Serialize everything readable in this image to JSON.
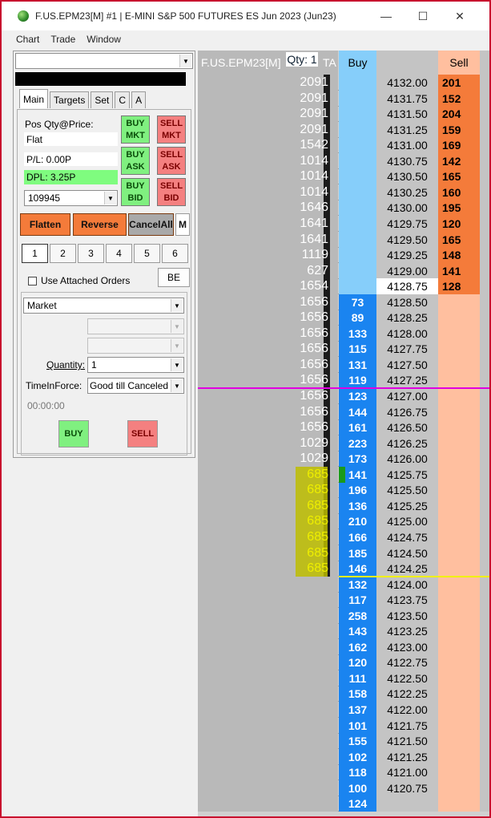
{
  "window": {
    "title": "F.US.EPM23[M]  #1 | E-MINI S&P 500 FUTURES ES Jun 2023 (Jun23)",
    "minimize": "—",
    "maximize": "☐",
    "close": "✕"
  },
  "menu": [
    "Chart",
    "Trade",
    "Window"
  ],
  "panel": {
    "account_value": "",
    "tabs": [
      "Main",
      "Targets",
      "Set",
      "C",
      "A"
    ],
    "pos_label": "Pos Qty@Price:",
    "pos_value": "Flat",
    "pl": "P/L: 0.00P",
    "dpl": "DPL: 3.25P",
    "account_id": "109945",
    "trade_buttons": [
      [
        "BUY",
        "MKT"
      ],
      [
        "SELL",
        "MKT"
      ],
      [
        "BUY",
        "ASK"
      ],
      [
        "SELL",
        "ASK"
      ],
      [
        "BUY",
        "BID"
      ],
      [
        "SELL",
        "BID"
      ]
    ],
    "flatten": "Flatten",
    "reverse": "Reverse",
    "cancel_all": "CancelAll",
    "m": "M",
    "numbers": [
      "1",
      "2",
      "3",
      "4",
      "5",
      "6"
    ],
    "attached_label": "Use Attached Orders",
    "be": "BE",
    "order_type": "Market",
    "quantity_label": "Quantity:",
    "quantity": "1",
    "tif_label": "TimeInForce:",
    "tif": "Good till Canceled",
    "timer": "00:00:00",
    "buy": "BUY",
    "sell": "SELL"
  },
  "ladder": {
    "symbol": "F.US.EPM23[M]",
    "qty": "Qty: 1",
    "ta": "TA",
    "buy_header": "Buy",
    "sell_header": "Sell",
    "colors": {
      "sell_strong": "#f47b3a",
      "sell_light": "#ffbf9f",
      "buy_strong": "#1a84f0",
      "buy_light": "#86cefa",
      "price_bg": "#c4c4c4",
      "vol_bg": "#b9b9b9"
    },
    "rows": [
      {
        "vol": "2091",
        "price": "4132.00",
        "sell": "201"
      },
      {
        "vol": "2091",
        "price": "4131.75",
        "sell": "152"
      },
      {
        "vol": "2091",
        "price": "4131.50",
        "sell": "204"
      },
      {
        "vol": "2091",
        "price": "4131.25",
        "sell": "159"
      },
      {
        "vol": "1542",
        "price": "4131.00",
        "sell": "169"
      },
      {
        "vol": "1014",
        "price": "4130.75",
        "sell": "142"
      },
      {
        "vol": "1014",
        "price": "4130.50",
        "sell": "165"
      },
      {
        "vol": "1014",
        "price": "4130.25",
        "sell": "160"
      },
      {
        "vol": "1646",
        "price": "4130.00",
        "sell": "195"
      },
      {
        "vol": "1641",
        "price": "4129.75",
        "sell": "120"
      },
      {
        "vol": "1641",
        "price": "4129.50",
        "sell": "165"
      },
      {
        "vol": "1119",
        "price": "4129.25",
        "sell": "148"
      },
      {
        "vol": "627",
        "price": "4129.00",
        "sell": "141"
      },
      {
        "vol": "1654",
        "price": "4128.75",
        "sell": "128",
        "last": true
      },
      {
        "vol": "1656",
        "price": "4128.50",
        "buy": "73"
      },
      {
        "vol": "1656",
        "price": "4128.25",
        "buy": "89"
      },
      {
        "vol": "1656",
        "price": "4128.00",
        "buy": "133"
      },
      {
        "vol": "1656",
        "price": "4127.75",
        "buy": "115"
      },
      {
        "vol": "1656",
        "price": "4127.50",
        "buy": "131"
      },
      {
        "vol": "1656",
        "price": "4127.25",
        "buy": "119"
      },
      {
        "vol": "1656",
        "price": "4127.00",
        "buy": "123"
      },
      {
        "vol": "1656",
        "price": "4126.75",
        "buy": "144"
      },
      {
        "vol": "1656",
        "price": "4126.50",
        "buy": "161"
      },
      {
        "vol": "1029",
        "price": "4126.25",
        "buy": "223"
      },
      {
        "vol": "1029",
        "price": "4126.00",
        "buy": "173"
      },
      {
        "vol": "685",
        "price": "4125.75",
        "buy": "141",
        "hl": true
      },
      {
        "vol": "685",
        "price": "4125.50",
        "buy": "196",
        "hl": true
      },
      {
        "vol": "685",
        "price": "4125.25",
        "buy": "136",
        "hl": true
      },
      {
        "vol": "685",
        "price": "4125.00",
        "buy": "210",
        "hl": true
      },
      {
        "vol": "685",
        "price": "4124.75",
        "buy": "166",
        "hl": true
      },
      {
        "vol": "685",
        "price": "4124.50",
        "buy": "185",
        "hl": true
      },
      {
        "vol": "685",
        "price": "4124.25",
        "buy": "146",
        "hl": true
      },
      {
        "vol": "",
        "price": "4124.00",
        "buy": "132"
      },
      {
        "vol": "",
        "price": "4123.75",
        "buy": "117"
      },
      {
        "vol": "",
        "price": "4123.50",
        "buy": "258"
      },
      {
        "vol": "",
        "price": "4123.25",
        "buy": "143"
      },
      {
        "vol": "",
        "price": "4123.00",
        "buy": "162"
      },
      {
        "vol": "",
        "price": "4122.75",
        "buy": "120"
      },
      {
        "vol": "",
        "price": "4122.50",
        "buy": "111"
      },
      {
        "vol": "",
        "price": "4122.25",
        "buy": "158"
      },
      {
        "vol": "",
        "price": "4122.00",
        "buy": "137"
      },
      {
        "vol": "",
        "price": "4121.75",
        "buy": "101"
      },
      {
        "vol": "",
        "price": "4121.50",
        "buy": "155"
      },
      {
        "vol": "",
        "price": "4121.25",
        "buy": "102"
      },
      {
        "vol": "",
        "price": "4121.00",
        "buy": "118"
      },
      {
        "vol": "",
        "price": "4120.75",
        "buy": "100"
      },
      {
        "vol": "",
        "price": "",
        "buy": "124"
      }
    ]
  }
}
